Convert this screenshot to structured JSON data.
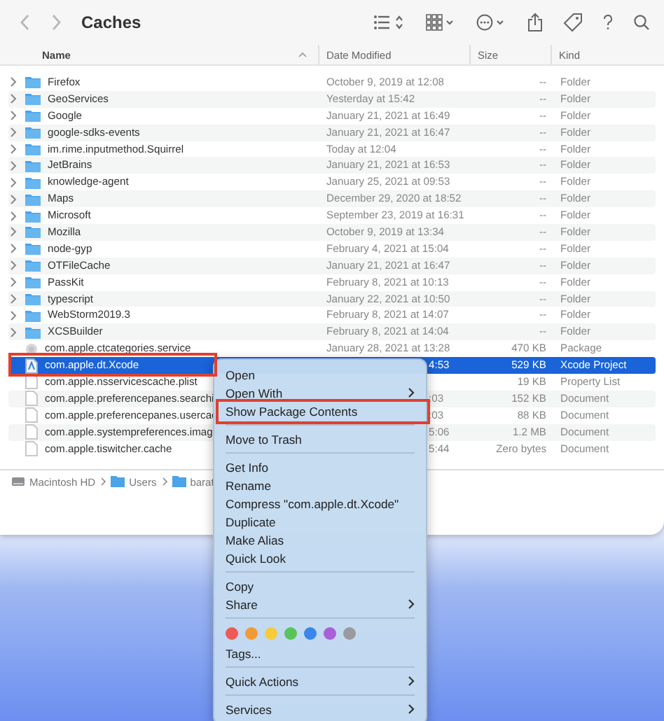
{
  "window": {
    "title": "Caches"
  },
  "columns": [
    {
      "label": "Name",
      "sorted": true
    },
    {
      "label": "Date Modified",
      "sorted": false
    },
    {
      "label": "Size",
      "sorted": false
    },
    {
      "label": "Kind",
      "sorted": false
    }
  ],
  "rows": [
    {
      "kind": "folder",
      "name": "Firefox",
      "date": "October 9, 2019 at 12:08",
      "size": "--",
      "file_kind": "Folder",
      "selected": false,
      "highlighted": false
    },
    {
      "kind": "folder",
      "name": "GeoServices",
      "date": "Yesterday at 15:42",
      "size": "--",
      "file_kind": "Folder",
      "selected": false,
      "highlighted": false
    },
    {
      "kind": "folder",
      "name": "Google",
      "date": "January 21, 2021 at 16:49",
      "size": "--",
      "file_kind": "Folder",
      "selected": false,
      "highlighted": false
    },
    {
      "kind": "folder",
      "name": "google-sdks-events",
      "date": "January 21, 2021 at 16:47",
      "size": "--",
      "file_kind": "Folder",
      "selected": false,
      "highlighted": false
    },
    {
      "kind": "folder",
      "name": "im.rime.inputmethod.Squirrel",
      "date": "Today at 12:04",
      "size": "--",
      "file_kind": "Folder",
      "selected": false,
      "highlighted": false
    },
    {
      "kind": "folder",
      "name": "JetBrains",
      "date": "January 21, 2021 at 16:53",
      "size": "--",
      "file_kind": "Folder",
      "selected": false,
      "highlighted": false
    },
    {
      "kind": "folder",
      "name": "knowledge-agent",
      "date": "January 25, 2021 at 09:53",
      "size": "--",
      "file_kind": "Folder",
      "selected": false,
      "highlighted": false
    },
    {
      "kind": "folder",
      "name": "Maps",
      "date": "December 29, 2020 at 18:52",
      "size": "--",
      "file_kind": "Folder",
      "selected": false,
      "highlighted": false
    },
    {
      "kind": "folder",
      "name": "Microsoft",
      "date": "September 23, 2019 at 16:31",
      "size": "--",
      "file_kind": "Folder",
      "selected": false,
      "highlighted": false
    },
    {
      "kind": "folder",
      "name": "Mozilla",
      "date": "October 9, 2019 at 13:34",
      "size": "--",
      "file_kind": "Folder",
      "selected": false,
      "highlighted": false
    },
    {
      "kind": "folder",
      "name": "node-gyp",
      "date": "February 4, 2021 at 15:04",
      "size": "--",
      "file_kind": "Folder",
      "selected": false,
      "highlighted": false
    },
    {
      "kind": "folder",
      "name": "OTFileCache",
      "date": "January 21, 2021 at 16:47",
      "size": "--",
      "file_kind": "Folder",
      "selected": false,
      "highlighted": false
    },
    {
      "kind": "folder",
      "name": "PassKit",
      "date": "February 8, 2021 at 10:13",
      "size": "--",
      "file_kind": "Folder",
      "selected": false,
      "highlighted": false
    },
    {
      "kind": "folder",
      "name": "typescript",
      "date": "January 22, 2021 at 10:50",
      "size": "--",
      "file_kind": "Folder",
      "selected": false,
      "highlighted": false
    },
    {
      "kind": "folder",
      "name": "WebStorm2019.3",
      "date": "February 8, 2021 at 14:07",
      "size": "--",
      "file_kind": "Folder",
      "selected": false,
      "highlighted": false
    },
    {
      "kind": "folder",
      "name": "XCSBuilder",
      "date": "February 8, 2021 at 14:04",
      "size": "--",
      "file_kind": "Folder",
      "selected": false,
      "highlighted": false
    },
    {
      "kind": "package",
      "name": "com.apple.ctcategories.service",
      "date": "January 28, 2021 at 13:28",
      "size": "470 KB",
      "file_kind": "Package",
      "selected": false,
      "highlighted": false
    },
    {
      "kind": "project",
      "name": "com.apple.dt.Xcode",
      "date": "4:53",
      "date_clipped": true,
      "size": "529 KB",
      "file_kind": "Xcode Project",
      "selected": true,
      "highlighted": true
    },
    {
      "kind": "file",
      "name": "com.apple.nsservicescache.plist",
      "size": "19 KB",
      "file_kind": "Property List",
      "selected": false,
      "highlighted": false
    },
    {
      "kind": "file",
      "name": "com.apple.preferencepanes.searchi",
      "date": ":03",
      "date_clipped": true,
      "size": "152 KB",
      "file_kind": "Document",
      "selected": false,
      "highlighted": false
    },
    {
      "kind": "file",
      "name": "com.apple.preferencepanes.usercac",
      "date": ":03",
      "date_clipped": true,
      "size": "88 KB",
      "file_kind": "Document",
      "selected": false,
      "highlighted": false
    },
    {
      "kind": "file",
      "name": "com.apple.systempreferences.image",
      "date": "5:06",
      "date_clipped": true,
      "size": "1.2 MB",
      "file_kind": "Document",
      "selected": false,
      "highlighted": false
    },
    {
      "kind": "file",
      "name": "com.apple.tiswitcher.cache",
      "date": "5:44",
      "date_clipped": true,
      "size": "Zero bytes",
      "file_kind": "Document",
      "selected": false,
      "highlighted": false
    }
  ],
  "path_bar": [
    {
      "kind": "disk",
      "label": "Macintosh HD"
    },
    {
      "kind": "folder",
      "label": "Users"
    },
    {
      "kind": "folder",
      "label": "barat"
    }
  ],
  "context_menu": [
    {
      "kind": "item",
      "label": "Open",
      "submenu": false,
      "highlighted": false
    },
    {
      "kind": "item",
      "label": "Open With",
      "submenu": true,
      "highlighted": false
    },
    {
      "kind": "item",
      "label": "Show Package Contents",
      "submenu": false,
      "highlighted": true
    },
    {
      "kind": "separator"
    },
    {
      "kind": "item",
      "label": "Move to Trash",
      "submenu": false,
      "highlighted": false
    },
    {
      "kind": "separator"
    },
    {
      "kind": "item",
      "label": "Get Info",
      "submenu": false,
      "highlighted": false
    },
    {
      "kind": "item",
      "label": "Rename",
      "submenu": false,
      "highlighted": false
    },
    {
      "kind": "item",
      "label": "Compress \"com.apple.dt.Xcode\"",
      "submenu": false,
      "highlighted": false
    },
    {
      "kind": "item",
      "label": "Duplicate",
      "submenu": false,
      "highlighted": false
    },
    {
      "kind": "item",
      "label": "Make Alias",
      "submenu": false,
      "highlighted": false
    },
    {
      "kind": "item",
      "label": "Quick Look",
      "submenu": false,
      "highlighted": false
    },
    {
      "kind": "separator"
    },
    {
      "kind": "item",
      "label": "Copy",
      "submenu": false,
      "highlighted": false
    },
    {
      "kind": "item",
      "label": "Share",
      "submenu": true,
      "highlighted": false
    },
    {
      "kind": "separator"
    },
    {
      "kind": "tags",
      "tags": [
        {
          "color": "#ee5a55"
        },
        {
          "color": "#f29a38"
        },
        {
          "color": "#f5cb3a"
        },
        {
          "color": "#5ac35a"
        },
        {
          "color": "#3a86ea"
        },
        {
          "color": "#a95fd6"
        },
        {
          "color": "#9a9a9e"
        }
      ]
    },
    {
      "kind": "item",
      "label": "Tags...",
      "submenu": false,
      "highlighted": false
    },
    {
      "kind": "separator"
    },
    {
      "kind": "item",
      "label": "Quick Actions",
      "submenu": true,
      "highlighted": false
    },
    {
      "kind": "separator"
    },
    {
      "kind": "item",
      "label": "Services",
      "submenu": true,
      "highlighted": false
    }
  ]
}
